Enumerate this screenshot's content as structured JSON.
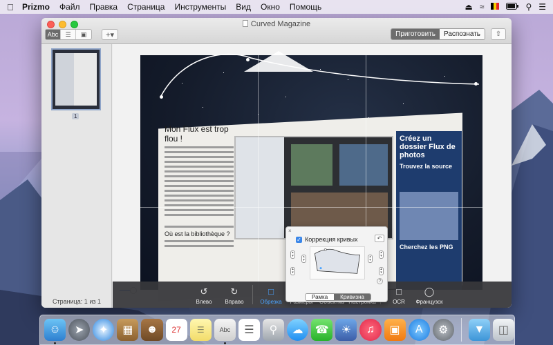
{
  "menubar": {
    "app": "Prizmo",
    "items": [
      "Файл",
      "Правка",
      "Страница",
      "Инструменты",
      "Вид",
      "Окно",
      "Помощь"
    ]
  },
  "window": {
    "title": "Curved Magazine",
    "mode_prepare": "Приготовить",
    "mode_recognize": "Распознать",
    "text_mode_label": "Abc"
  },
  "sidebar": {
    "page_number": "1",
    "page_count": "Страница: 1 из 1"
  },
  "document": {
    "article_title": "Mon Flux est trop flou !",
    "right_heading": "Créez un dossier Flux de photos",
    "right_sub1": "Trouvez la source",
    "right_sub2": "Cherchez les PNG",
    "bottom_heading": "Où est la bibliothèque ?"
  },
  "popover": {
    "checkbox_label": "Коррекция кривых",
    "checkbox_checked": true,
    "tab_frame": "Рамка",
    "tab_curve": "Кривизна",
    "selected_tab": "Кривизна"
  },
  "toolbar": {
    "items": [
      {
        "label": "Влево",
        "icon": "rotate-left-icon"
      },
      {
        "label": "Вправо",
        "icon": "rotate-right-icon"
      },
      {
        "label": "Обрезка",
        "icon": "crop-icon",
        "active": true
      },
      {
        "label": "Размеры",
        "icon": "ruler-icon"
      },
      {
        "label": "Объектив",
        "icon": "camera-icon"
      },
      {
        "label": "Настройка",
        "icon": "sliders-icon"
      },
      {
        "label": "OCR",
        "icon": "ocr-icon"
      },
      {
        "label": "Французск",
        "icon": "globe-icon"
      }
    ]
  },
  "colors": {
    "accent": "#4aa3ff",
    "close": "#fc5f57",
    "minimize": "#fdbc2e",
    "maximize": "#28c840"
  }
}
